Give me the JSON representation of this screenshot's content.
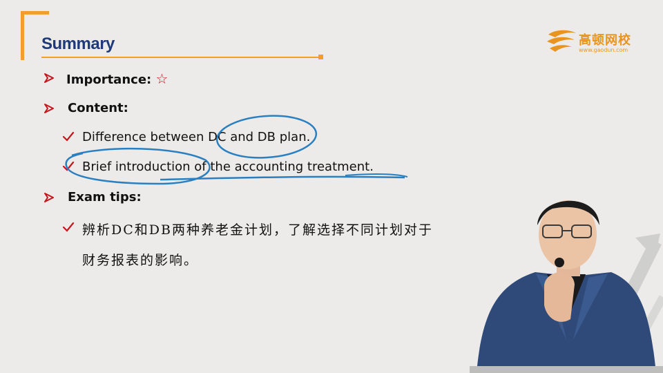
{
  "slide": {
    "title": "Summary",
    "logo": {
      "name": "高顿网校",
      "url": "www.gaodun.com"
    },
    "items": [
      {
        "label": "Importance:",
        "star": "☆"
      },
      {
        "label": "Content:"
      },
      {
        "label": "Exam tips:"
      }
    ],
    "content_points": [
      "Difference between DC and DB plan.",
      "Brief introduction of the accounting treatment."
    ],
    "exam_tip_lines": [
      "辨析DC和DB两种养老金计划，了解选择不同计划对于",
      "财务报表的影响。"
    ]
  },
  "colors": {
    "title": "#1f3a7a",
    "accent": "#f0a02a",
    "bullet": "#c4161c",
    "annotation": "#2a7fc0"
  }
}
